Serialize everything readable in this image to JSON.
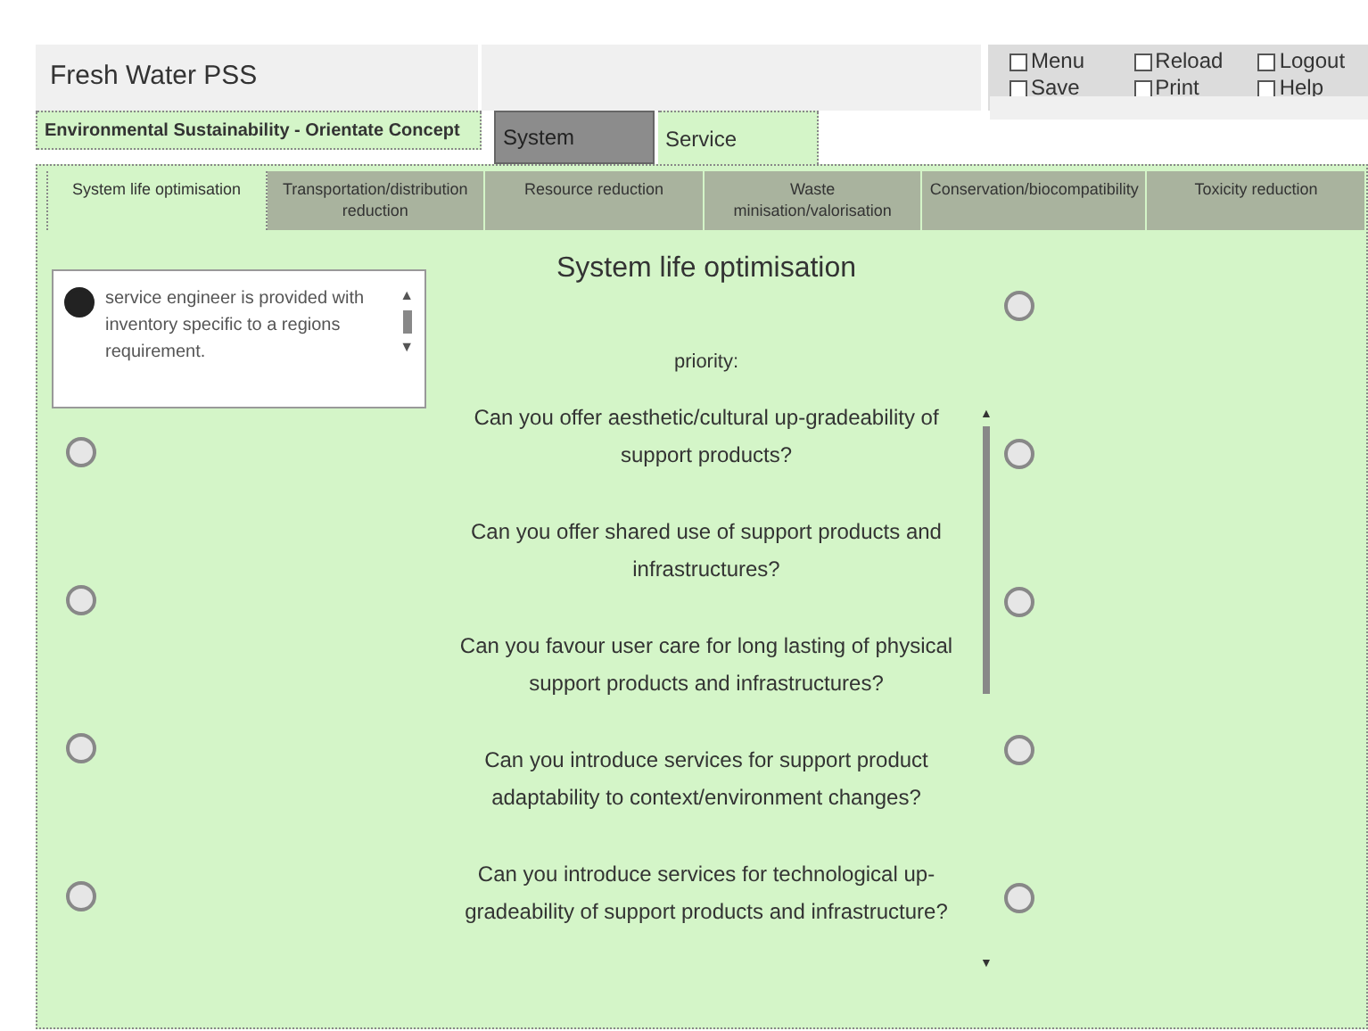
{
  "app_title": "Fresh Water PSS",
  "menu": [
    {
      "label": "Menu",
      "checked": false
    },
    {
      "label": "Reload",
      "checked": false
    },
    {
      "label": "Logout",
      "checked": false
    },
    {
      "label": "Save",
      "checked": false
    },
    {
      "label": "Print",
      "checked": false
    },
    {
      "label": "Help",
      "checked": false
    }
  ],
  "section_label": "Environmental Sustainability - Orientate Concept",
  "mode_tabs": [
    {
      "label": "System",
      "selected": false
    },
    {
      "label": "Service",
      "selected": true
    }
  ],
  "strategy_tabs": [
    {
      "label": "System life optimisation",
      "selected": true
    },
    {
      "label": "Transportation/distribution reduction",
      "selected": false
    },
    {
      "label": "Resource reduction",
      "selected": false
    },
    {
      "label": "Waste minisation/valorisation",
      "selected": false
    },
    {
      "label": "Conservation/biocompatibility",
      "selected": false
    },
    {
      "label": "Toxicity reduction",
      "selected": false
    }
  ],
  "answer_box": {
    "text": "service engineer is provided with inventory specific to a regions requirement.",
    "selected": true
  },
  "left_options": [
    {
      "selected": false
    },
    {
      "selected": false
    },
    {
      "selected": false
    },
    {
      "selected": false
    }
  ],
  "heading": "System life optimisation",
  "priority_label": "priority:",
  "questions": [
    "Can you offer aesthetic/cultural up-gradeability of support products?",
    "Can you offer shared use of  support products and infrastructures?",
    "Can you favour user care for long lasting of physical support products and infrastructures?",
    "Can you introduce services for support product adaptability to context/environment changes?",
    "Can you introduce services for technological up-gradeability of support products and infrastructure?"
  ],
  "right_options": [
    {
      "selected": false
    },
    {
      "selected": false
    },
    {
      "selected": false
    },
    {
      "selected": false
    },
    {
      "selected": false
    }
  ],
  "scroll_up": "▲",
  "scroll_down": "▼"
}
